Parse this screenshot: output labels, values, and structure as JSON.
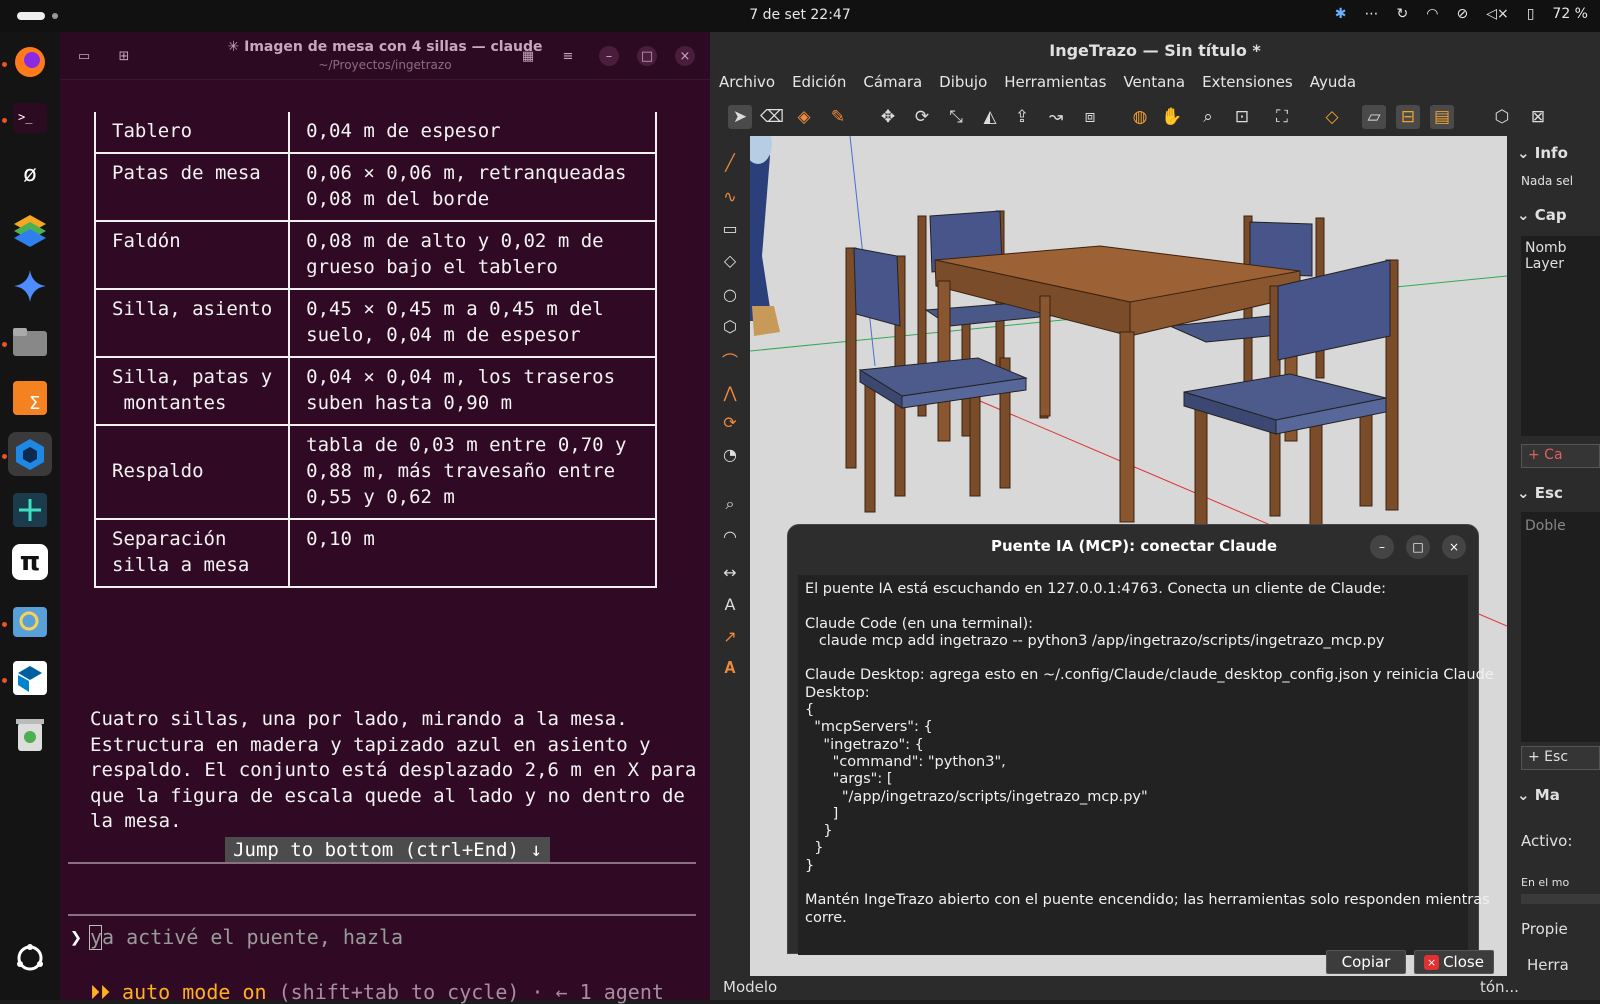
{
  "system": {
    "clock": "7 de set  22:47",
    "battery": "72 %",
    "tray_icons": [
      "bluetooth-icon",
      "more-icon",
      "sync-icon",
      "wifi-icon",
      "mic-muted-icon",
      "volume-muted-icon",
      "battery-icon"
    ]
  },
  "dock": {
    "apps": [
      "firefox-icon",
      "terminal-icon",
      "app-icon",
      "layers-icon",
      "gemini-icon",
      "files-icon",
      "spreadsheet-icon",
      "ingetrazo-icon",
      "cad-icon",
      "pi-icon",
      "viewer-icon",
      "sketchup-icon",
      "trash-icon",
      "apps-grid-icon"
    ]
  },
  "terminal": {
    "title": "✳ Imagen de mesa con 4 sillas — claude",
    "subtitle": "~/Proyectos/ingetrazo",
    "table_rows": [
      {
        "k": "Tablero",
        "v": "0,04 m de espesor"
      },
      {
        "k": "Patas de mesa",
        "v": "0,06 × 0,06 m, retranqueadas\n0,08 m del borde"
      },
      {
        "k": "Faldón",
        "v": "0,08 m de alto y 0,02 m de\ngrueso bajo el tablero"
      },
      {
        "k": "Silla, asiento",
        "v": "0,45 × 0,45 m a 0,45 m del\nsuelo, 0,04 m de espesor"
      },
      {
        "k": "Silla, patas y\n montantes",
        "v": "0,04 × 0,04 m, los traseros\nsuben hasta 0,90 m"
      },
      {
        "k": "Respaldo",
        "v": "tabla de 0,03 m entre 0,70 y\n0,88 m, más travesaño entre\n0,55 y 0,62 m"
      },
      {
        "k": "Separación\nsilla a mesa",
        "v": "0,10 m"
      }
    ],
    "paragraph": "Cuatro sillas, una por lado, mirando a la mesa.\nEstructura en madera y tapizado azul en asiento y\nrespaldo. El conjunto está desplazado 2,6 m en X para\nque la figura de escala quede al lado y no dentro de\nla mesa.",
    "jump_label": "Jump to bottom (ctrl+End) ↓",
    "prompt_symbol": "❯",
    "input_text": "ya activé el puente, hazla",
    "mode_icon": "⏵⏵",
    "mode_label": "auto mode on",
    "mode_hint": " (shift+tab to cycle) · ← 1 agent"
  },
  "cad": {
    "title": "IngeTrazo — Sin título *",
    "menu": [
      "Archivo",
      "Edición",
      "Cámara",
      "Dibujo",
      "Herramientas",
      "Ventana",
      "Extensiones",
      "Ayuda"
    ],
    "status_label": "Modelo",
    "status_right_1": "tón...",
    "status_right_2": "Herra",
    "panel": {
      "info_label": "Info",
      "info_text": "Nada sel",
      "layers_label": "Cap",
      "layers_col": "Nomb",
      "layers_row": "Layer",
      "add_layer": "+ Ca",
      "scenes_label": "Esc",
      "scenes_text": "Doble",
      "add_scene": "+ Esc",
      "materials_label": "Ma",
      "active_label": "Activo:",
      "model_label": "En el mo",
      "props_label": "Propie"
    }
  },
  "dialog": {
    "title": "Puente IA (MCP): conectar Claude",
    "body": "El puente IA está escuchando en 127.0.0.1:4763. Conecta un cliente de Claude:\n\nClaude Code (en una terminal):\n   claude mcp add ingetrazo -- python3 /app/ingetrazo/scripts/ingetrazo_mcp.py\n\nClaude Desktop: agrega esto en ~/.config/Claude/claude_desktop_config.json y reinicia Claude\nDesktop:\n{\n  \"mcpServers\": {\n    \"ingetrazo\": {\n      \"command\": \"python3\",\n      \"args\": [\n        \"/app/ingetrazo/scripts/ingetrazo_mcp.py\"\n      ]\n    }\n  }\n}\n\nMantén IngeTrazo abierto con el puente encendido; las herramientas solo responden mientras\ncorre.",
    "copy_label": "Copiar",
    "close_label": "Close"
  }
}
